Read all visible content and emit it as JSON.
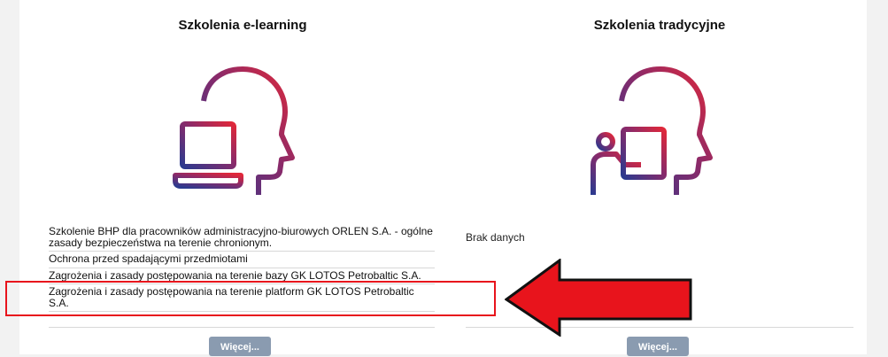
{
  "columns": {
    "elearning": {
      "title": "Szkolenia e-learning",
      "icon": "laptop-head-icon",
      "courses": [
        "Szkolenie BHP dla pracowników administracyjno-biurowych ORLEN S.A. - ogólne zasady bezpieczeństwa na terenie chronionym.",
        "Ochrona przed spadającymi przedmiotami",
        "Zagrożenia i zasady postępowania na terenie bazy GK LOTOS Petrobaltic S.A.",
        "Zagrożenia i zasady postępowania na terenie platform GK LOTOS Petrobaltic S.A."
      ],
      "more_label": "Więcej..."
    },
    "traditional": {
      "title": "Szkolenia tradycyjne",
      "icon": "presenter-head-icon",
      "empty_text": "Brak danych",
      "more_label": "Więcej..."
    }
  },
  "annotation": {
    "highlight_color": "#e8141c",
    "arrow": "left-arrow-icon"
  },
  "colors": {
    "gradient_start": "#2b3a8f",
    "gradient_end": "#e0283a",
    "button": "#8a9bb0"
  }
}
